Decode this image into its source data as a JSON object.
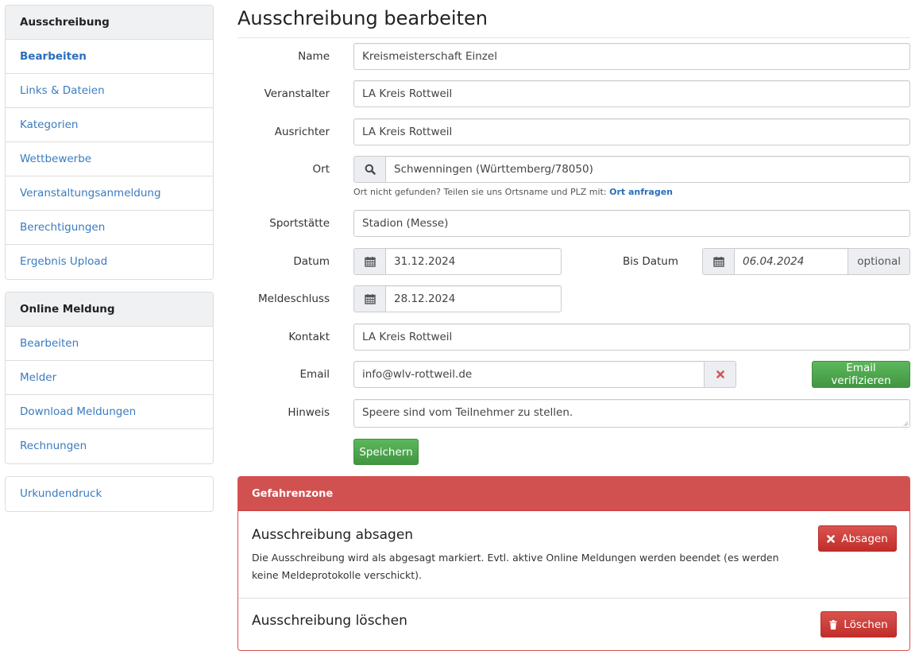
{
  "sidebar": {
    "sections": [
      {
        "title": "Ausschreibung",
        "items": [
          {
            "label": "Bearbeiten",
            "active": true
          },
          {
            "label": "Links & Dateien"
          },
          {
            "label": "Kategorien"
          },
          {
            "label": "Wettbewerbe"
          },
          {
            "label": "Veranstaltungsanmeldung"
          },
          {
            "label": "Berechtigungen"
          },
          {
            "label": "Ergebnis Upload"
          }
        ]
      },
      {
        "title": "Online Meldung",
        "items": [
          {
            "label": "Bearbeiten"
          },
          {
            "label": "Melder"
          },
          {
            "label": "Download Meldungen"
          },
          {
            "label": "Rechnungen"
          }
        ]
      },
      {
        "items": [
          {
            "label": "Urkundendruck"
          }
        ]
      }
    ]
  },
  "main": {
    "title": "Ausschreibung bearbeiten",
    "form": {
      "name": {
        "label": "Name",
        "value": "Kreismeisterschaft Einzel"
      },
      "veranstalter": {
        "label": "Veranstalter",
        "value": "LA Kreis Rottweil"
      },
      "ausrichter": {
        "label": "Ausrichter",
        "value": "LA Kreis Rottweil"
      },
      "ort": {
        "label": "Ort",
        "icon": "search-icon",
        "value": "Schwenningen (Württemberg/78050)",
        "help_text": "Ort nicht gefunden? Teilen sie uns Ortsname und PLZ mit:",
        "help_link": "Ort anfragen"
      },
      "sportstaette": {
        "label": "Sportstätte",
        "value": "Stadion (Messe)"
      },
      "datum": {
        "label": "Datum",
        "icon": "calendar-icon",
        "value": "31.12.2024"
      },
      "bis_datum": {
        "label": "Bis Datum",
        "icon": "calendar-icon",
        "placeholder": "06.04.2024",
        "addon": "optional"
      },
      "meldeschluss": {
        "label": "Meldeschluss",
        "icon": "calendar-icon",
        "value": "28.12.2024"
      },
      "kontakt": {
        "label": "Kontakt",
        "value": "LA Kreis Rottweil"
      },
      "email": {
        "label": "Email",
        "value": "info@wlv-rottweil.de",
        "clear_icon": "close-icon",
        "verify_label": "Email verifizieren"
      },
      "hinweis": {
        "label": "Hinweis",
        "value": "Speere sind vom Teilnehmer zu stellen."
      },
      "save_label": "Speichern"
    },
    "danger_zone": {
      "title": "Gefahrenzone",
      "cancel": {
        "heading": "Ausschreibung absagen",
        "text": "Die Ausschreibung wird als abgesagt markiert. Evtl. aktive Online Meldungen werden beendet (es werden keine Meldeprotokolle verschickt).",
        "button_label": "Absagen",
        "button_icon": "close-icon"
      },
      "delete": {
        "heading": "Ausschreibung löschen",
        "button_label": "Löschen",
        "button_icon": "trash-icon"
      }
    }
  },
  "colors": {
    "link": "#3a7bbf",
    "success": "#4cae4c",
    "danger": "#d15050"
  }
}
